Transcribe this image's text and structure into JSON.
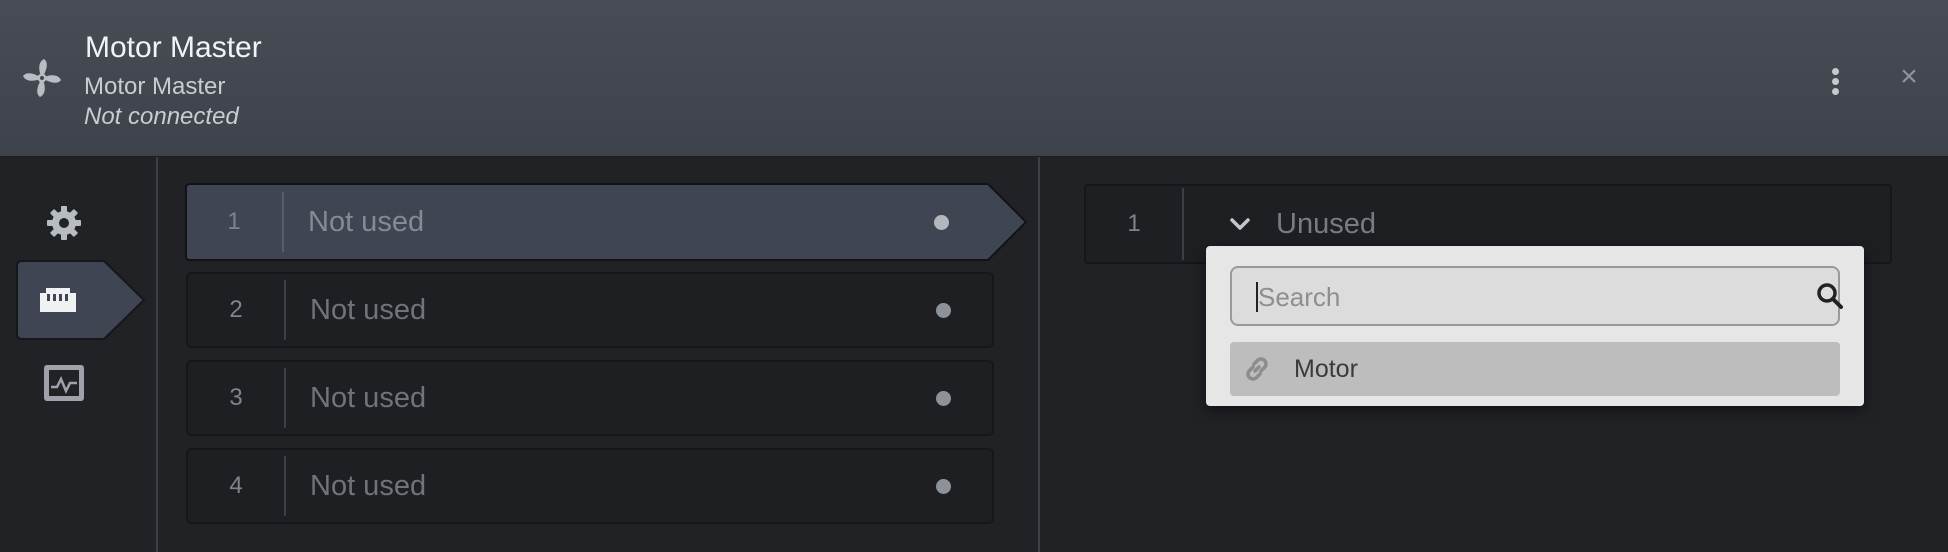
{
  "header": {
    "title": "Motor Master",
    "subtitle": "Motor Master",
    "status": "Not connected",
    "close_glyph": "×",
    "icon": "fan-icon"
  },
  "nav": {
    "items": [
      {
        "icon": "gear-icon"
      },
      {
        "icon": "ethernet-port-icon",
        "active": true
      },
      {
        "icon": "monitor-icon"
      }
    ]
  },
  "ports": [
    {
      "number": "1",
      "label": "Not used",
      "selected": true
    },
    {
      "number": "2",
      "label": "Not used"
    },
    {
      "number": "3",
      "label": "Not used"
    },
    {
      "number": "4",
      "label": "Not used"
    }
  ],
  "assignment": {
    "number": "1",
    "value": "Unused"
  },
  "dropdown": {
    "search_placeholder": "Search",
    "search_value": "",
    "options": [
      {
        "label": "Motor",
        "icon": "link-icon"
      }
    ]
  },
  "colors": {
    "header_bg": "#434850",
    "body_bg": "#202226",
    "selected_port_bg": "#3f4552",
    "dropdown_bg": "#e6e6e6"
  }
}
